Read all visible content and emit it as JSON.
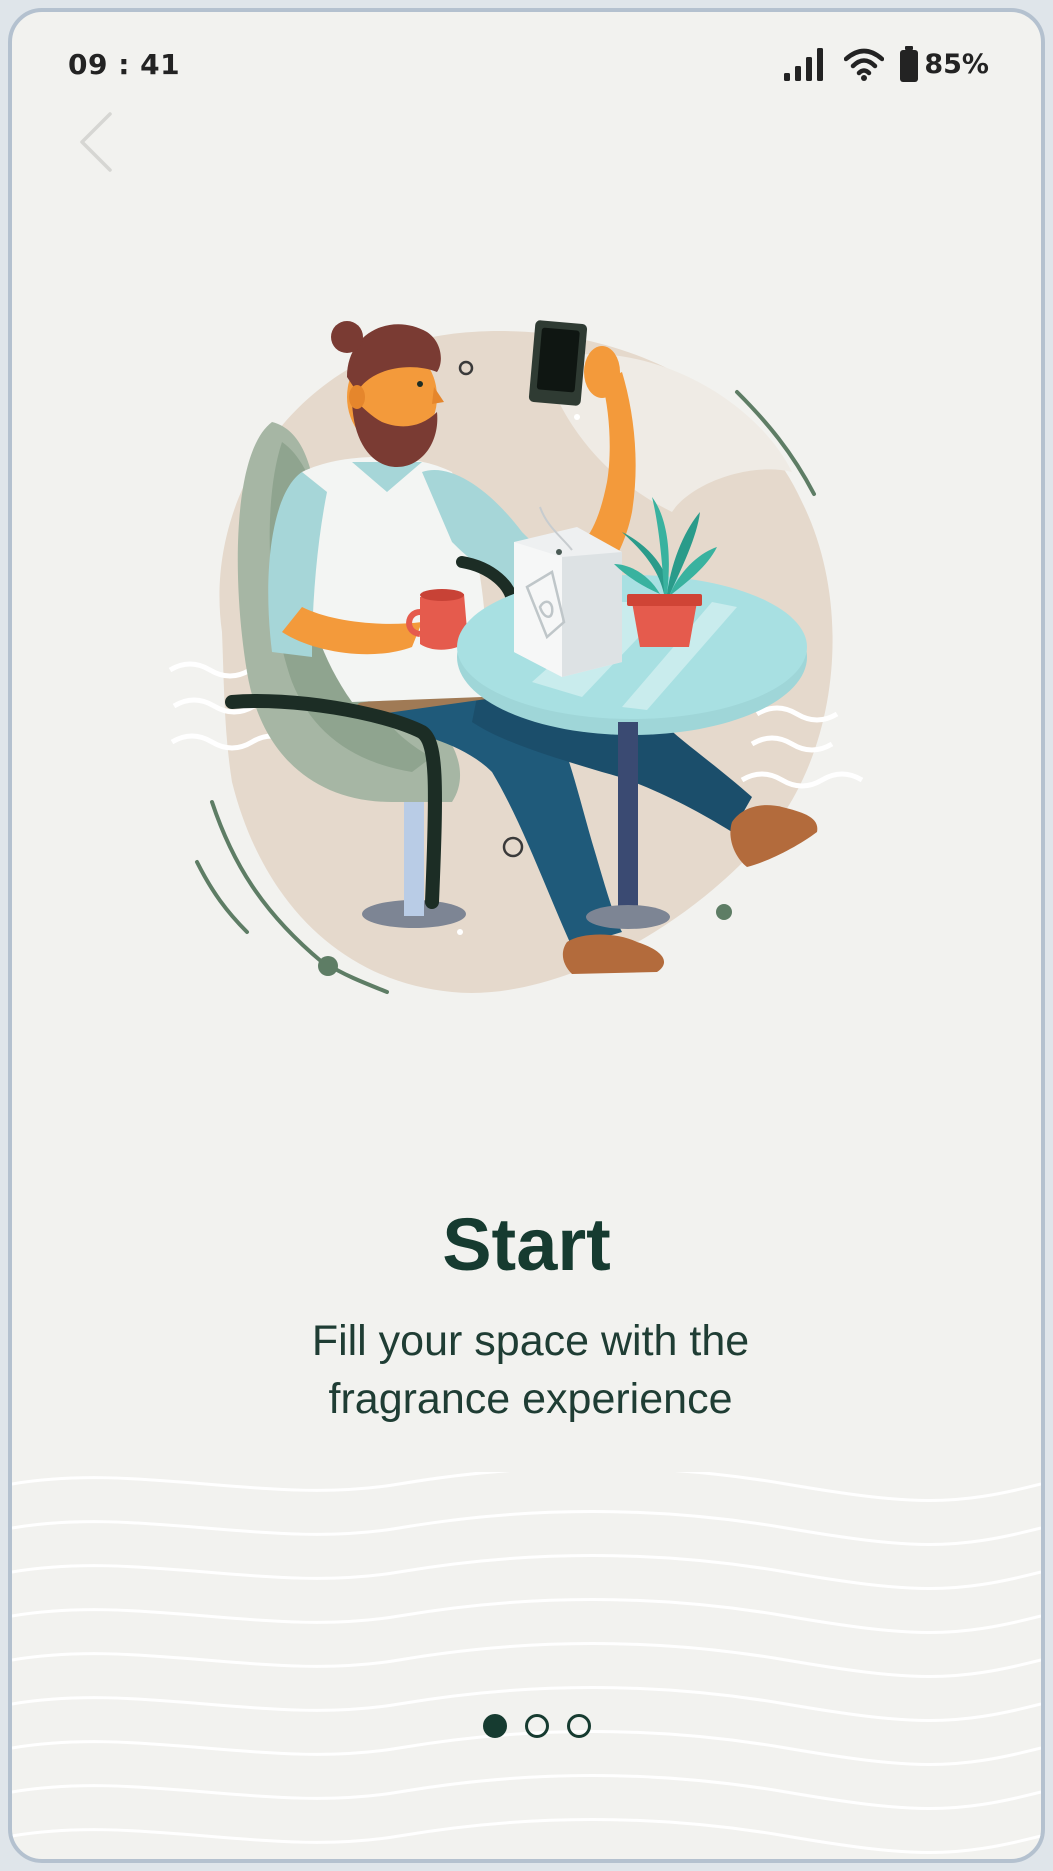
{
  "status_bar": {
    "time": "09 : 41",
    "battery_percent": "85%",
    "icons": [
      "signal-icon",
      "wifi-icon",
      "battery-icon"
    ]
  },
  "navigation": {
    "back_icon": "chevron-left-icon"
  },
  "onboarding": {
    "title": "Start",
    "subtitle_line1": "Fill your space with the",
    "subtitle_line2": "fragrance experience",
    "page_indicator": {
      "total": 3,
      "active_index": 0
    }
  },
  "colors": {
    "background": "#f2f2ef",
    "primary_dark_green": "#163b30",
    "accent_green": "#5e7d65",
    "blob_beige": "#e5d9cc",
    "table_teal": "#9fd6d8",
    "skin_orange": "#f39a3b"
  }
}
